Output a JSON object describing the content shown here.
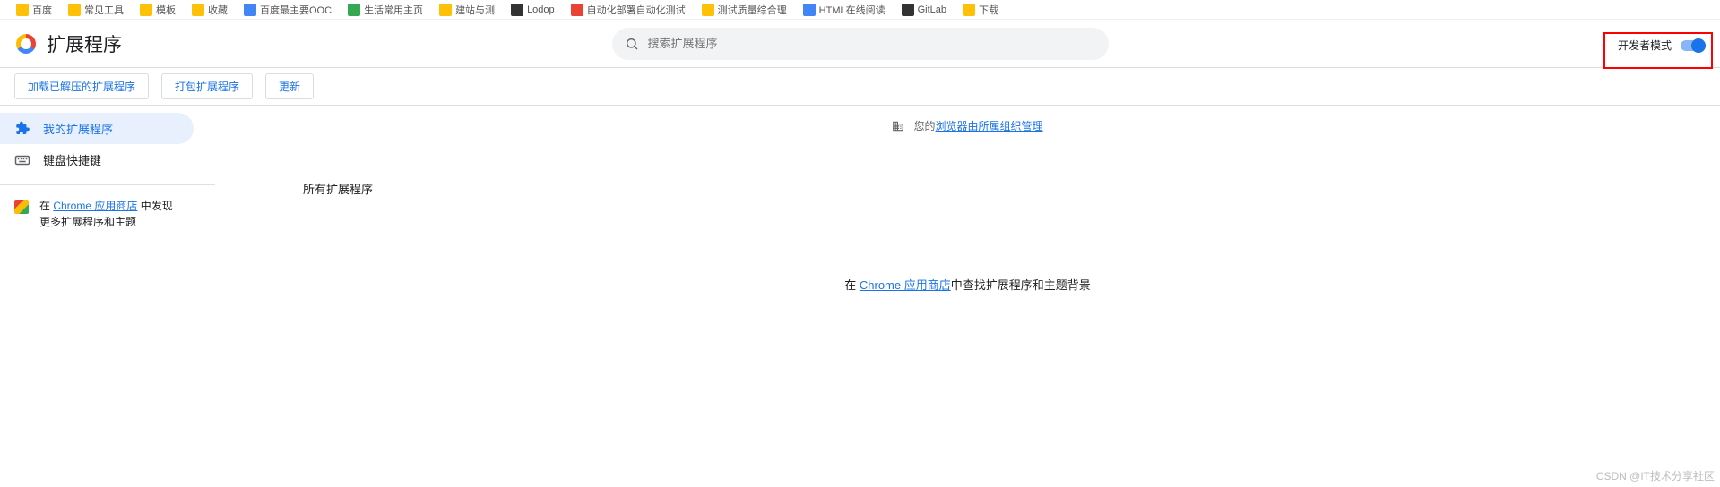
{
  "bookmarks": [
    "百度",
    "常见工具",
    "模板",
    "收藏",
    "百度最主要OOC",
    "生活常用主页",
    "建站与测",
    "Lodop",
    "自动化部署自动化测试",
    "测试质量综合理",
    "HTML在线阅读",
    "GitLab",
    "下载"
  ],
  "header": {
    "title": "扩展程序",
    "search_placeholder": "搜索扩展程序",
    "dev_mode_label": "开发者模式",
    "dev_mode_on": true
  },
  "actions": {
    "load_unpacked": "加载已解压的扩展程序",
    "pack_extension": "打包扩展程序",
    "update": "更新"
  },
  "sidebar": {
    "my_extensions": "我的扩展程序",
    "keyboard_shortcuts": "键盘快捷键",
    "store_prefix": "在 ",
    "store_link_text": "Chrome 应用商店",
    "store_suffix1": " 中发现",
    "store_suffix2": "更多扩展程序和主题"
  },
  "content": {
    "org_prefix": "您的",
    "org_link": "浏览器由所属组织管理",
    "section_all": "所有扩展程序",
    "empty_prefix": "在 ",
    "empty_link": "Chrome 应用商店",
    "empty_suffix": "中查找扩展程序和主题背景"
  },
  "watermark": "CSDN @IT技术分享社区"
}
